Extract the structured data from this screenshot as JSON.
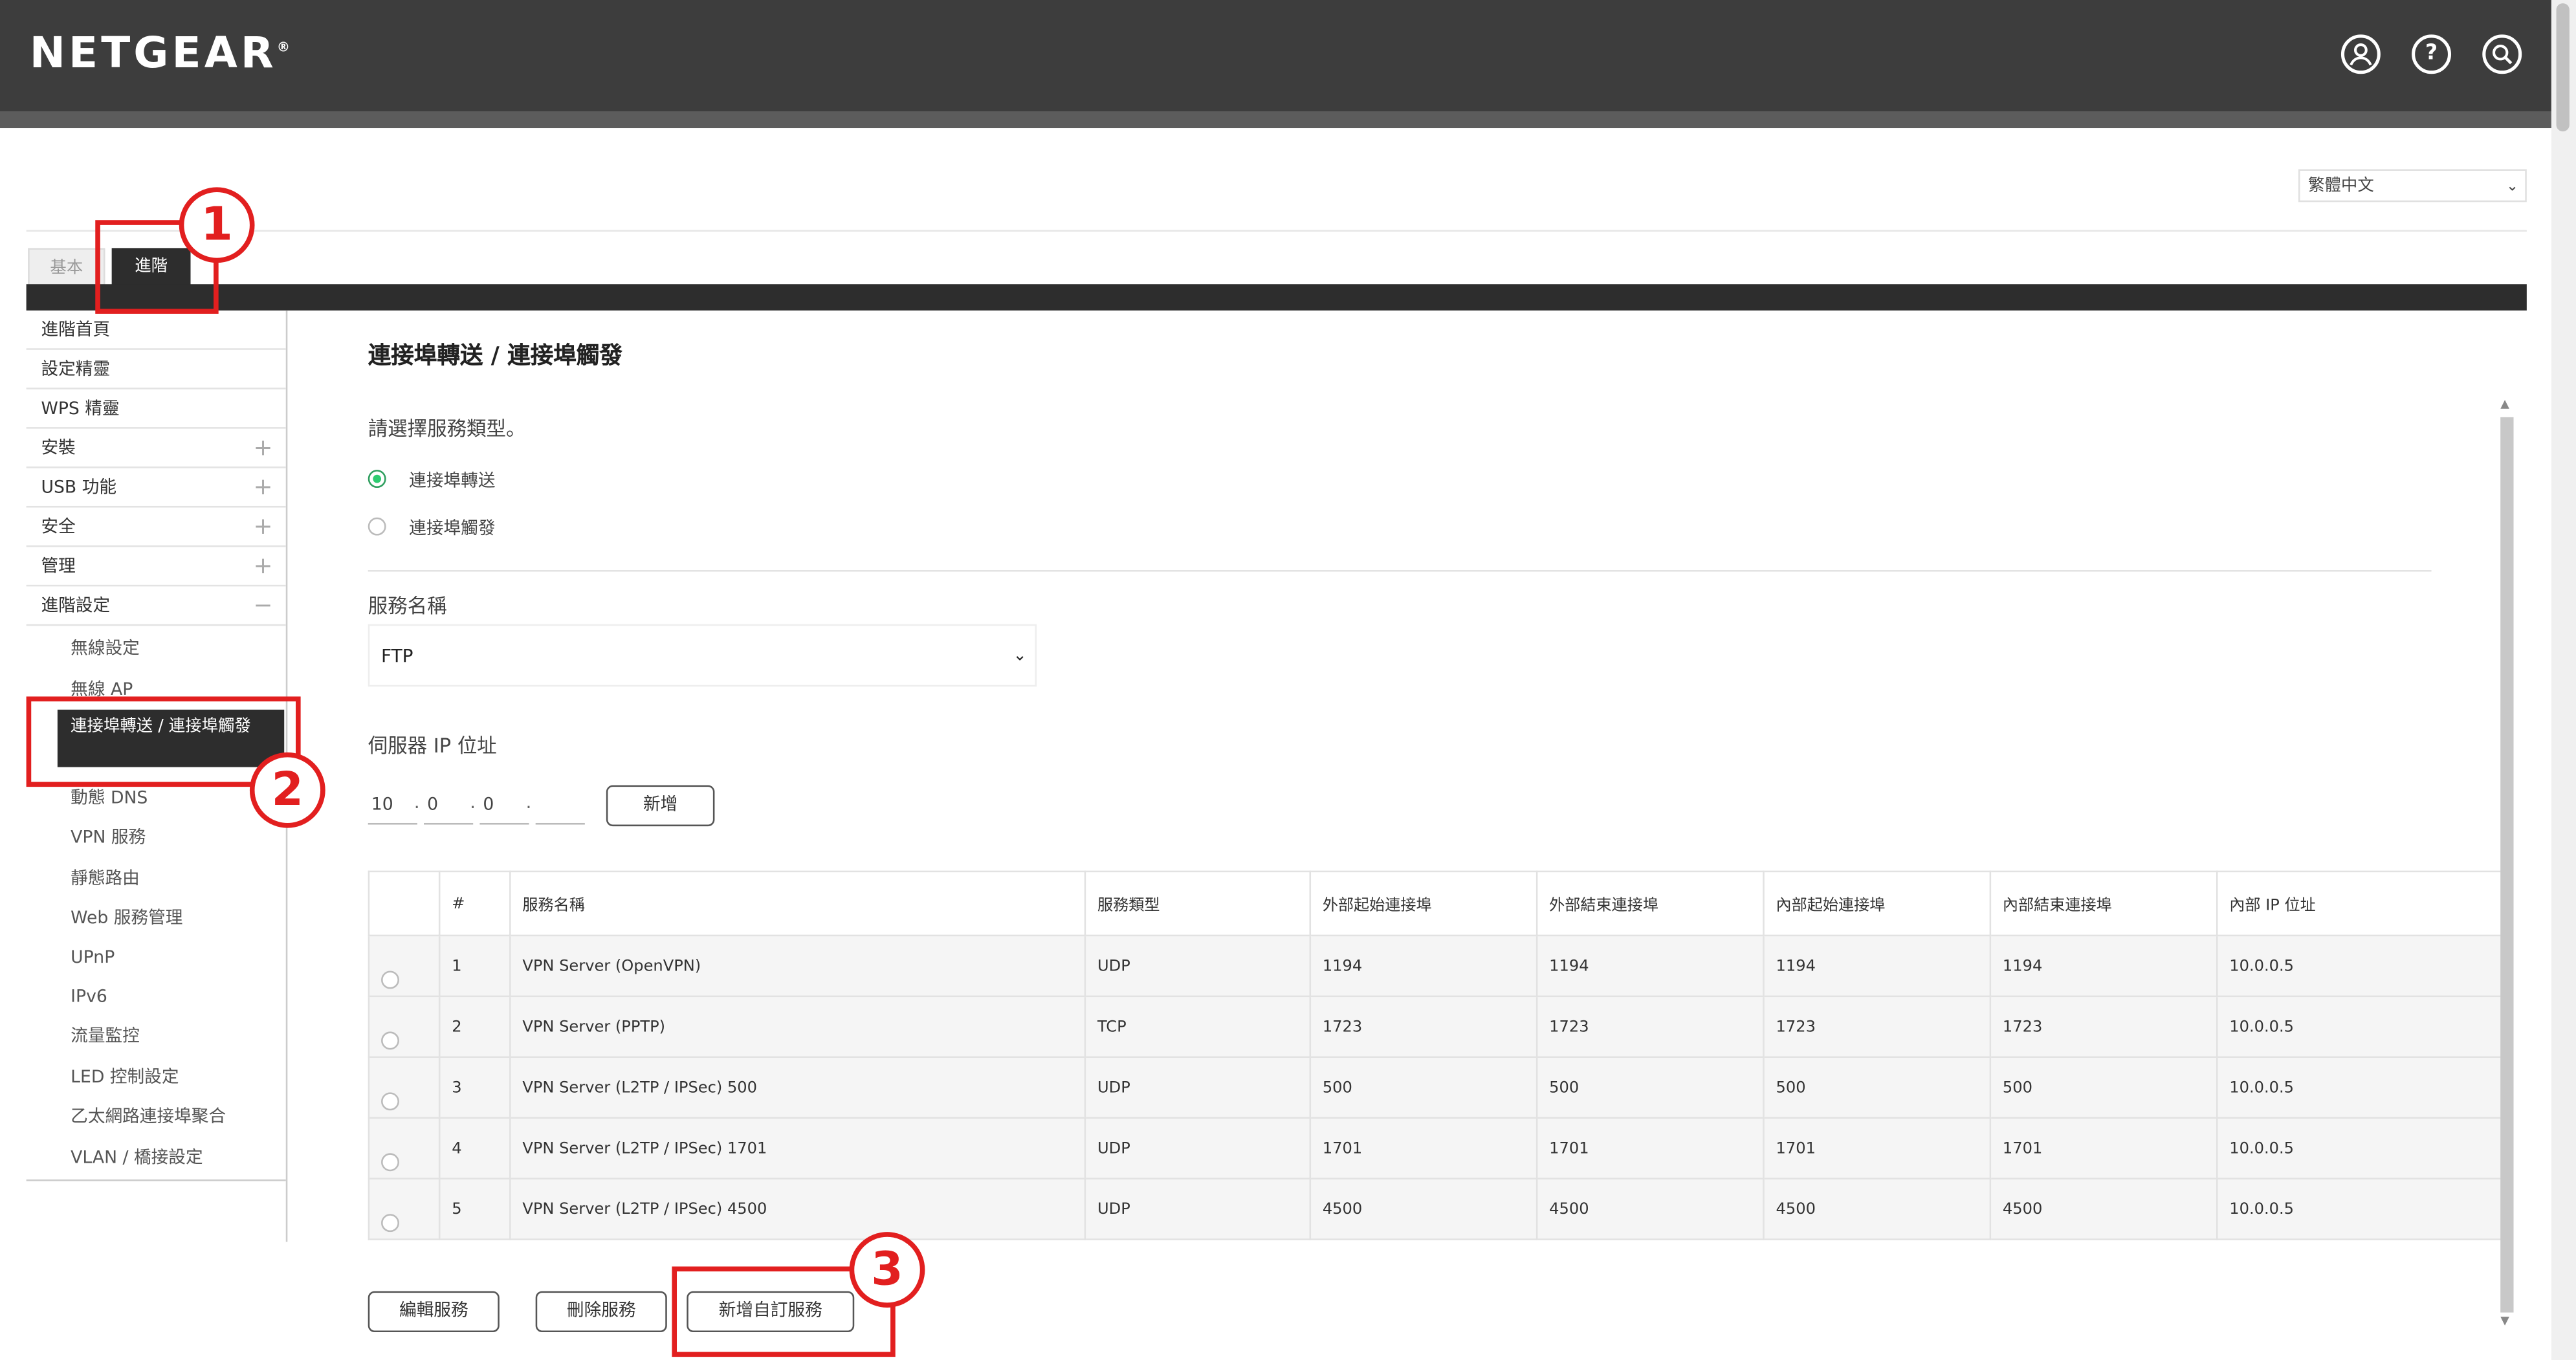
{
  "header": {
    "logo": "NETGEAR",
    "logo_mark": "®",
    "icons": [
      "user-icon",
      "help-icon",
      "search-icon"
    ]
  },
  "language": {
    "selected": "繁體中文"
  },
  "tabs": [
    {
      "label": "基本",
      "active": false
    },
    {
      "label": "進階",
      "active": true
    }
  ],
  "sidebar": {
    "items": [
      {
        "label": "進階首頁",
        "sign": ""
      },
      {
        "label": "設定精靈",
        "sign": ""
      },
      {
        "label": "WPS 精靈",
        "sign": ""
      },
      {
        "label": "安裝",
        "sign": "+"
      },
      {
        "label": "USB 功能",
        "sign": "+"
      },
      {
        "label": "安全",
        "sign": "+"
      },
      {
        "label": "管理",
        "sign": "+"
      },
      {
        "label": "進階設定",
        "sign": "−"
      }
    ],
    "subitems": [
      "無線設定",
      "無線 AP",
      "連接埠轉送 / 連接埠觸發",
      "動態 DNS",
      "VPN 服務",
      "靜態路由",
      "Web 服務管理",
      "UPnP",
      "IPv6",
      "流量監控",
      "LED 控制設定",
      "乙太網路連接埠聚合",
      "VLAN / 橋接設定"
    ],
    "active_label": "連接埠轉送 / 連接埠觸發"
  },
  "main": {
    "title": "連接埠轉送 / 連接埠觸發",
    "service_type_label": "請選擇服務類型。",
    "radio_forward": "連接埠轉送",
    "radio_trigger": "連接埠觸發",
    "service_name_label": "服務名稱",
    "service_name_value": "FTP",
    "server_ip_label": "伺服器 IP 位址",
    "ip": [
      "10",
      "0",
      "0",
      ""
    ],
    "add_button": "新增"
  },
  "table": {
    "headers": [
      "",
      "#",
      "服務名稱",
      "服務類型",
      "外部起始連接埠",
      "外部結束連接埠",
      "內部起始連接埠",
      "內部結束連接埠",
      "內部 IP 位址"
    ],
    "rows": [
      [
        "1",
        "VPN Server (OpenVPN)",
        "UDP",
        "1194",
        "1194",
        "1194",
        "1194",
        "10.0.0.5"
      ],
      [
        "2",
        "VPN Server (PPTP)",
        "TCP",
        "1723",
        "1723",
        "1723",
        "1723",
        "10.0.0.5"
      ],
      [
        "3",
        "VPN Server (L2TP / IPSec) 500",
        "UDP",
        "500",
        "500",
        "500",
        "500",
        "10.0.0.5"
      ],
      [
        "4",
        "VPN Server (L2TP / IPSec) 1701",
        "UDP",
        "1701",
        "1701",
        "1701",
        "1701",
        "10.0.0.5"
      ],
      [
        "5",
        "VPN Server (L2TP / IPSec) 4500",
        "UDP",
        "4500",
        "4500",
        "4500",
        "4500",
        "10.0.0.5"
      ]
    ]
  },
  "buttons": {
    "edit": "編輯服務",
    "delete": "刪除服務",
    "add_custom": "新增自訂服務"
  },
  "annotations": {
    "b1": "1",
    "b2": "2",
    "b3": "3",
    "color": "#e21f1f"
  },
  "colors": {
    "header_bg": "#3d3d3d",
    "active_nav": "#2d2d2d",
    "radio_on": "#2ecc71"
  }
}
